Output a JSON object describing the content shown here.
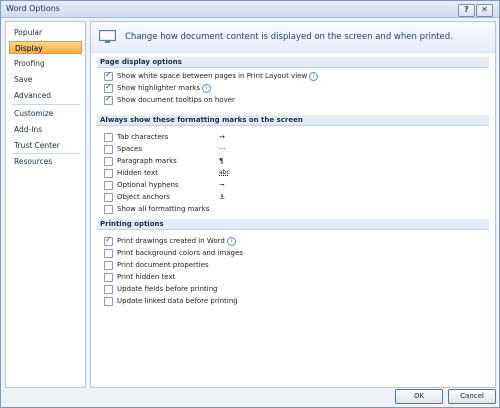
{
  "window": {
    "title": "Word Options",
    "help_glyph": "?",
    "close_glyph": "✕"
  },
  "sidebar": {
    "items": [
      {
        "label": "Popular"
      },
      {
        "label": "Display"
      },
      {
        "label": "Proofing"
      },
      {
        "label": "Save"
      },
      {
        "label": "Advanced"
      },
      {
        "label": "Customize"
      },
      {
        "label": "Add-Ins"
      },
      {
        "label": "Trust Center"
      },
      {
        "label": "Resources"
      }
    ],
    "selected": "Display"
  },
  "header": {
    "text": "Change how document content is displayed on the screen and when printed."
  },
  "sections": {
    "page_display": {
      "title": "Page display options",
      "options": [
        {
          "label": "Show white space between pages in Print Layout view",
          "checked": true
        },
        {
          "label": "Show highlighter marks",
          "checked": true
        },
        {
          "label": "Show document tooltips on hover",
          "checked": true
        }
      ]
    },
    "formatting_marks": {
      "title": "Always show these formatting marks on the screen",
      "options": [
        {
          "label": "Tab characters",
          "mark": "→",
          "checked": false
        },
        {
          "label": "Spaces",
          "mark": "···",
          "checked": false
        },
        {
          "label": "Paragraph marks",
          "mark": "¶",
          "checked": false
        },
        {
          "label": "Hidden text",
          "mark": "abc",
          "checked": false
        },
        {
          "label": "Optional hyphens",
          "mark": "¬",
          "checked": false
        },
        {
          "label": "Object anchors",
          "mark": "⚓",
          "checked": false
        },
        {
          "label": "Show all formatting marks",
          "checked": false
        }
      ]
    },
    "printing": {
      "title": "Printing options",
      "options": [
        {
          "label": "Print drawings created in Word",
          "checked": true
        },
        {
          "label": "Print background colors and images",
          "checked": false
        },
        {
          "label": "Print document properties",
          "checked": false
        },
        {
          "label": "Print hidden text",
          "checked": false
        },
        {
          "label": "Update fields before printing",
          "checked": false
        },
        {
          "label": "Update linked data before printing",
          "checked": false
        }
      ]
    }
  },
  "info_glyph": "i",
  "buttons": {
    "ok": "OK",
    "cancel": "Cancel"
  },
  "colors": {
    "selection": "#f7ad45",
    "section_band": "#e4ebf6",
    "header_text": "#1f3f70"
  }
}
